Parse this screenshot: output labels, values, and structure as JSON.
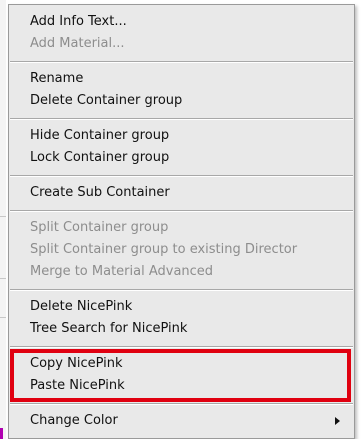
{
  "menu": {
    "groups": [
      [
        {
          "label": "Add Info Text...",
          "disabled": false
        },
        {
          "label": "Add Material...",
          "disabled": true
        }
      ],
      [
        {
          "label": "Rename",
          "disabled": false
        },
        {
          "label": "Delete Container group",
          "disabled": false
        }
      ],
      [
        {
          "label": "Hide Container group",
          "disabled": false
        },
        {
          "label": "Lock Container group",
          "disabled": false
        }
      ],
      [
        {
          "label": "Create Sub Container",
          "disabled": false
        }
      ],
      [
        {
          "label": "Split Container group",
          "disabled": true
        },
        {
          "label": "Split Container group to existing Director",
          "disabled": true
        },
        {
          "label": "Merge to Material Advanced",
          "disabled": true
        }
      ],
      [
        {
          "label": "Delete NicePink",
          "disabled": false
        },
        {
          "label": "Tree Search for NicePink",
          "disabled": false
        }
      ],
      [
        {
          "label": "Copy NicePink",
          "disabled": false
        },
        {
          "label": "Paste NicePink",
          "disabled": false
        }
      ],
      [
        {
          "label": "Change Color",
          "disabled": false,
          "submenu": true
        }
      ]
    ]
  },
  "colors": {
    "menu_background": "#e9e9e9",
    "enabled_text": "#111111",
    "disabled_text": "#8d8d8d",
    "highlight_outline": "#e00010"
  }
}
